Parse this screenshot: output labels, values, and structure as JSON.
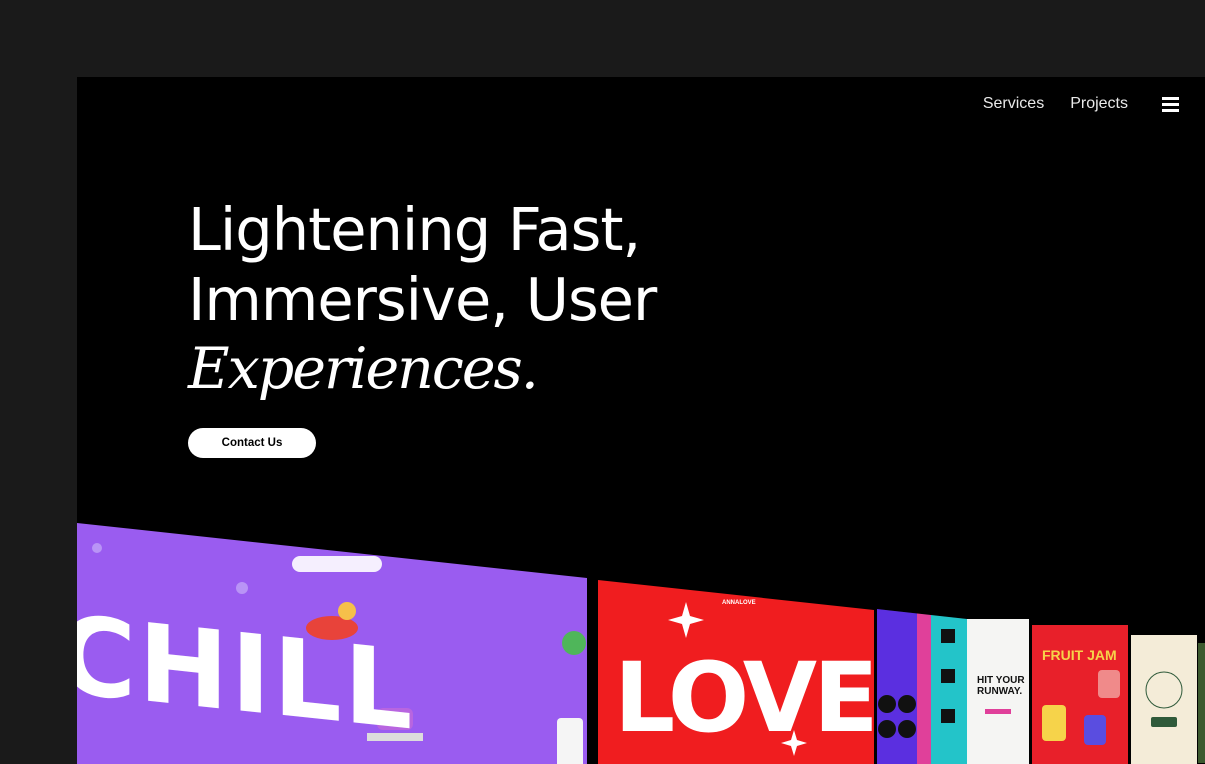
{
  "nav": {
    "items": [
      "Services",
      "Projects"
    ],
    "menu_icon": "hamburger-icon"
  },
  "hero": {
    "line1": "Lightening Fast,",
    "line2": "Immersive, User",
    "line3": "Experiences.",
    "cta_label": "Contact Us"
  },
  "showcase": {
    "chill_text": "CHILL",
    "love_brand": "ANNALOVE",
    "love_text": "LOVE",
    "runway_text": "HIT YOUR RUNWAY.",
    "jam_text": "FRUIT JAM"
  },
  "colors": {
    "background": "#000000",
    "purple": "#9a5cf0",
    "red": "#f01d1f",
    "text": "#ffffff"
  }
}
